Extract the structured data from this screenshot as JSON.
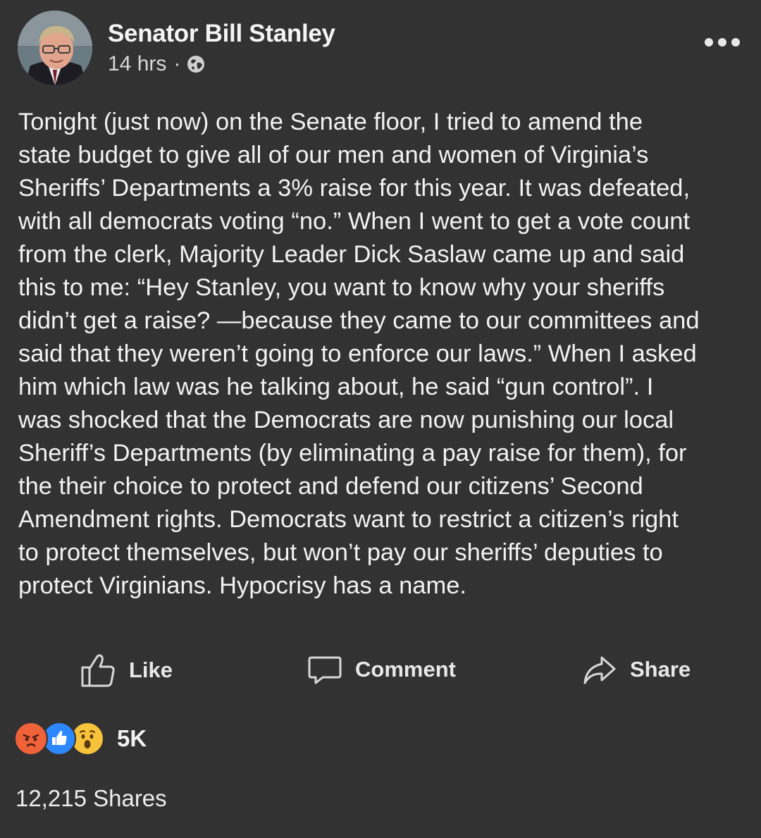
{
  "post": {
    "author": "Senator Bill Stanley",
    "time": "14 hrs",
    "separator": "·",
    "privacy_icon": "globe-icon",
    "more_icon": "more-options-icon",
    "text_lines": [
      "Tonight (just now) on the Senate floor, I tried to amend the",
      "state budget to give all of our men and women of Virginia’s",
      "Sheriffs’ Departments a 3% raise for this year. It was defeated,",
      "with all democrats voting “no.” When I went to get a vote count",
      "from the clerk, Majority Leader Dick Saslaw came up and said",
      "this to me: “Hey Stanley, you want to know why your sheriffs",
      "didn’t get a raise? —because they came to our committees and",
      "said that they weren’t going to enforce our laws.” When I asked",
      "him which law was he talking about, he said “gun control”. I",
      "was shocked that the Democrats are now punishing our local",
      "Sheriff’s Departments (by eliminating a pay raise for them), for",
      "the their choice to protect and defend our citizens’ Second",
      "Amendment rights. Democrats want to restrict a citizen’s right",
      "to protect themselves, but won’t pay our sheriffs’ deputies to",
      "protect Virginians. Hypocrisy has a name."
    ]
  },
  "actions": {
    "like_label": "Like",
    "comment_label": "Comment",
    "share_label": "Share"
  },
  "reactions": {
    "icons": [
      "angry-reaction-icon",
      "like-reaction-icon",
      "wow-reaction-icon"
    ],
    "count": "5K"
  },
  "shares": "12,215 Shares",
  "colors": {
    "background": "#323232",
    "text": "#f2f2f2",
    "like_blue": "#2d88ff",
    "angry_orange": "#f0623a",
    "wow_yellow": "#f7c33b"
  }
}
